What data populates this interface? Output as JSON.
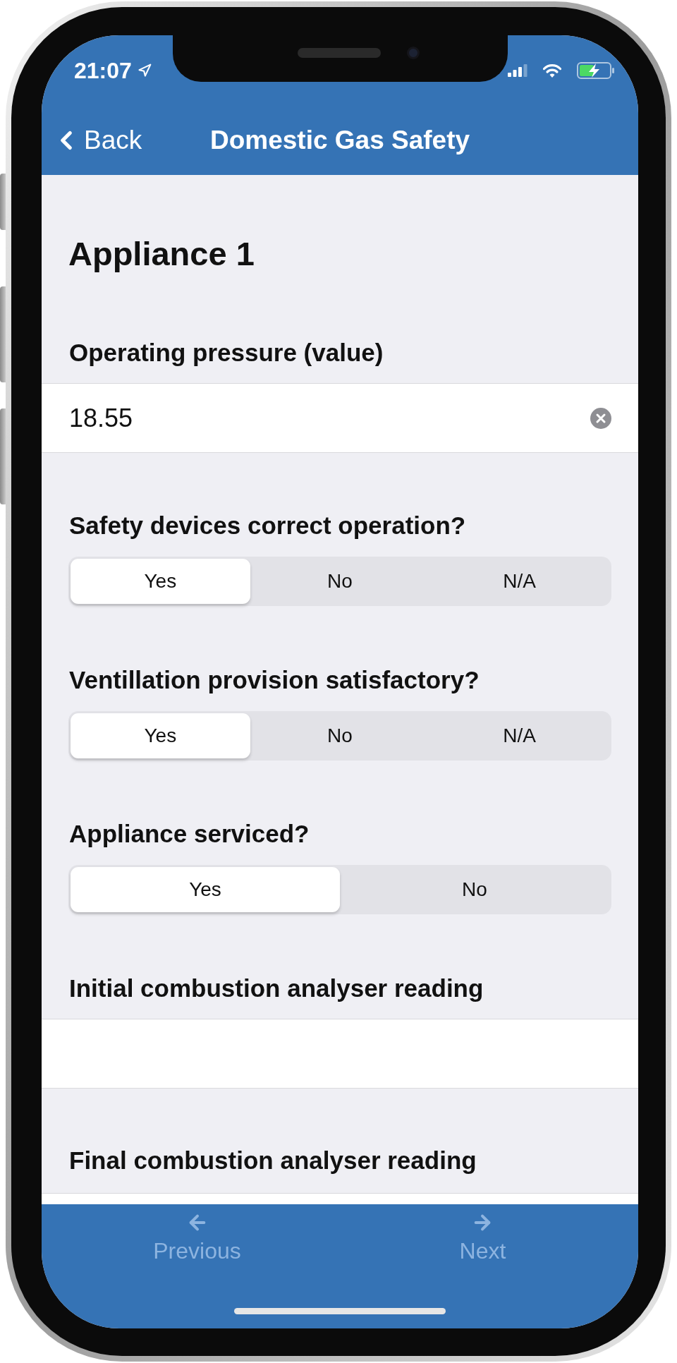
{
  "status_bar": {
    "time": "21:07"
  },
  "nav_bar": {
    "back_label": "Back",
    "title": "Domestic Gas Safety"
  },
  "section_title": "Appliance 1",
  "fields": [
    {
      "kind": "text",
      "label": "Operating pressure (value)",
      "value": "18.55"
    },
    {
      "kind": "segmented",
      "label": "Safety devices correct operation?",
      "options": [
        {
          "label": "Yes",
          "selected": true
        },
        {
          "label": "No",
          "selected": false
        },
        {
          "label": "N/A",
          "selected": false
        }
      ]
    },
    {
      "kind": "segmented",
      "label": "Ventillation provision satisfactory?",
      "options": [
        {
          "label": "Yes",
          "selected": true
        },
        {
          "label": "No",
          "selected": false
        },
        {
          "label": "N/A",
          "selected": false
        }
      ]
    },
    {
      "kind": "segmented",
      "label": "Appliance serviced?",
      "options": [
        {
          "label": "Yes",
          "selected": true
        },
        {
          "label": "No",
          "selected": false
        }
      ]
    },
    {
      "kind": "text",
      "label": "Initial combustion analyser reading"
    },
    {
      "kind": "text",
      "label": "Final combustion analyser reading"
    }
  ],
  "footer": {
    "buttons": [
      {
        "kind": "previous",
        "label": "Previous"
      },
      {
        "kind": "next",
        "label": "Next"
      }
    ]
  }
}
